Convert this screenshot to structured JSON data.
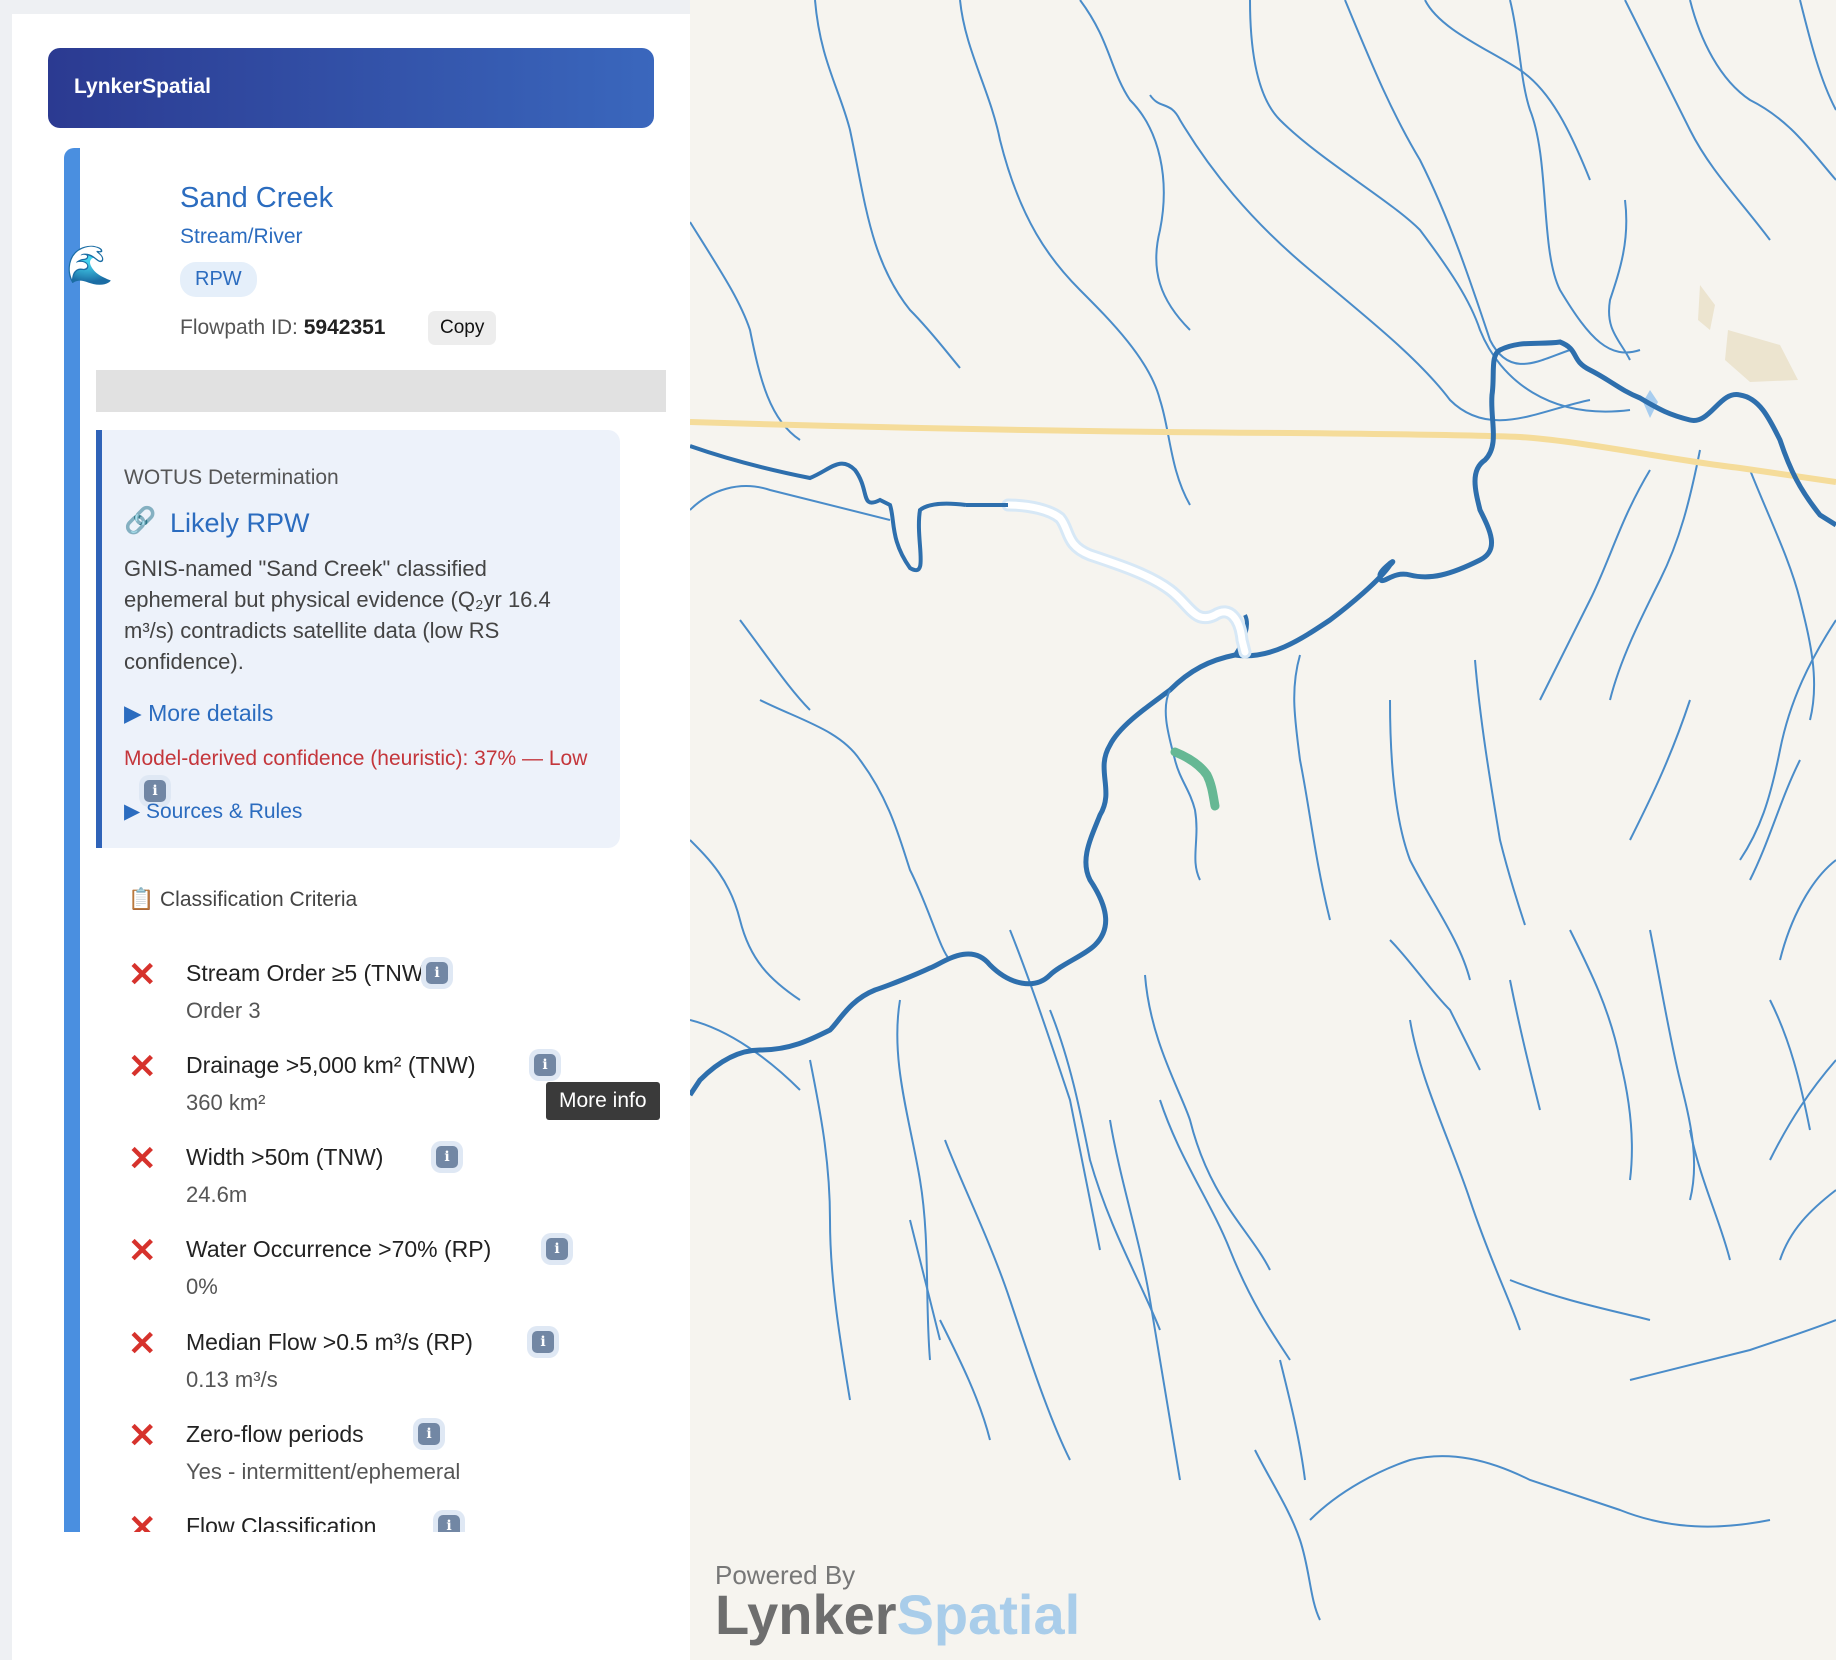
{
  "brand": {
    "name": "LynkerSpatial"
  },
  "feature": {
    "icon": "wave-icon",
    "name": "Sand Creek",
    "type": "Stream/River",
    "badge": "RPW",
    "flowpath_label": "Flowpath ID:",
    "flowpath_id": "5942351",
    "copy_label": "Copy"
  },
  "wotus": {
    "label": "WOTUS Determination",
    "link_icon": "link-icon",
    "result": "Likely RPW",
    "description": "GNIS-named \"Sand Creek\" classified ephemeral but physical evidence (Q₂yr 16.4 m³/s) contradicts satellite data (low RS confidence).",
    "more_details": "▶ More details",
    "confidence": "Model-derived confidence (heuristic): 37% — Low",
    "sources": "▶ Sources & Rules"
  },
  "criteria": {
    "heading": "📋 Classification Criteria",
    "items": [
      {
        "name": "Stream Order ≥5 (TNW)",
        "value": "Order 3",
        "status": "fail"
      },
      {
        "name": "Drainage >5,000 km² (TNW)",
        "value": "360 km²",
        "status": "fail"
      },
      {
        "name": "Width >50m (TNW)",
        "value": "24.6m",
        "status": "fail"
      },
      {
        "name": "Water Occurrence >70% (RP)",
        "value": "0%",
        "status": "fail"
      },
      {
        "name": "Median Flow >0.5 m³/s (RP)",
        "value": "0.13 m³/s",
        "status": "fail"
      },
      {
        "name": "Zero-flow periods",
        "value": "Yes - intermittent/ephemeral",
        "status": "fail"
      },
      {
        "name": "Flow Classification",
        "value": "",
        "status": "fail"
      }
    ],
    "fail_symbol": "✕",
    "info_symbol": "i"
  },
  "tooltip": {
    "text": "More info"
  },
  "map": {
    "powered_by": "Powered By",
    "logo_part1": "Lynker",
    "logo_part2": "Spatial",
    "colors": {
      "background": "#f6f4ef",
      "stream": "#4a8cc9",
      "main_river": "#2e6fad",
      "road": "#f5dc9a",
      "selected": "#ffffff",
      "highlight": "#66b894"
    }
  }
}
